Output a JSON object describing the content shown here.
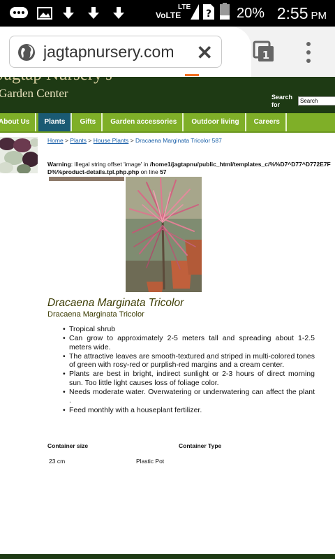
{
  "status_bar": {
    "icons": [
      "chat-bubble-icon",
      "image-icon",
      "download-icon",
      "download-icon",
      "download-icon"
    ],
    "network": "VoLTE",
    "lte": "LTE",
    "battery_percent": "20%",
    "time": "2:55",
    "ampm": "PM"
  },
  "browser": {
    "url": "jagtapnursery.com",
    "tab_count": "1"
  },
  "site": {
    "brand": "Jagtap Nursery's",
    "subtitle": "Garden Center",
    "search_label": "Search for",
    "search_placeholder": "Search"
  },
  "nav": {
    "items": [
      {
        "label": "About Us"
      },
      {
        "label": "Plants"
      },
      {
        "label": "Gifts"
      },
      {
        "label": "Garden accessories"
      },
      {
        "label": "Outdoor living"
      },
      {
        "label": "Careers"
      }
    ]
  },
  "breadcrumb": {
    "home": "Home",
    "sep": ">",
    "plants": "Plants",
    "house_plants": "House Plants",
    "current": "Dracaena Marginata Tricolor 587"
  },
  "warning": {
    "label": "Warning",
    "text1": ": Illegal string offset 'image' in ",
    "path": "/home1/jagtapnu/public_html/templates_c/%%D7^D77^D772E7FD%%product-details.tpl.php.php",
    "text2": " on line ",
    "line": "57"
  },
  "product": {
    "title": "Dracaena Marginata Tricolor",
    "subtitle": "Dracaena Marginata Tricolor",
    "features": [
      "Tropical shrub",
      "Can grow to approximately 2-5 meters tall and spreading about 1-2.5 meters wide.",
      "The attractive leaves are smooth-textured and striped in multi-colored tones of green with rosy-red or purplish-red margins and a cream center.",
      "Plants are best in bright, indirect sunlight or 2-3 hours of direct morning sun. Too little light causes loss of foliage color.",
      "Needs moderate water. Overwatering or underwatering can affect the plant .",
      "Feed monthly with a houseplant fertilizer."
    ],
    "attributes": {
      "size_label": "Container size",
      "type_label": "Container Type",
      "size_value": "23 cm",
      "type_value": "Plastic Pot"
    }
  },
  "colors": {
    "header_bg": "#1e3a14",
    "nav_bg": "#7faf28",
    "nav_active": "#1a5a73",
    "link": "#1a5fa8",
    "progress": "#f37021"
  }
}
